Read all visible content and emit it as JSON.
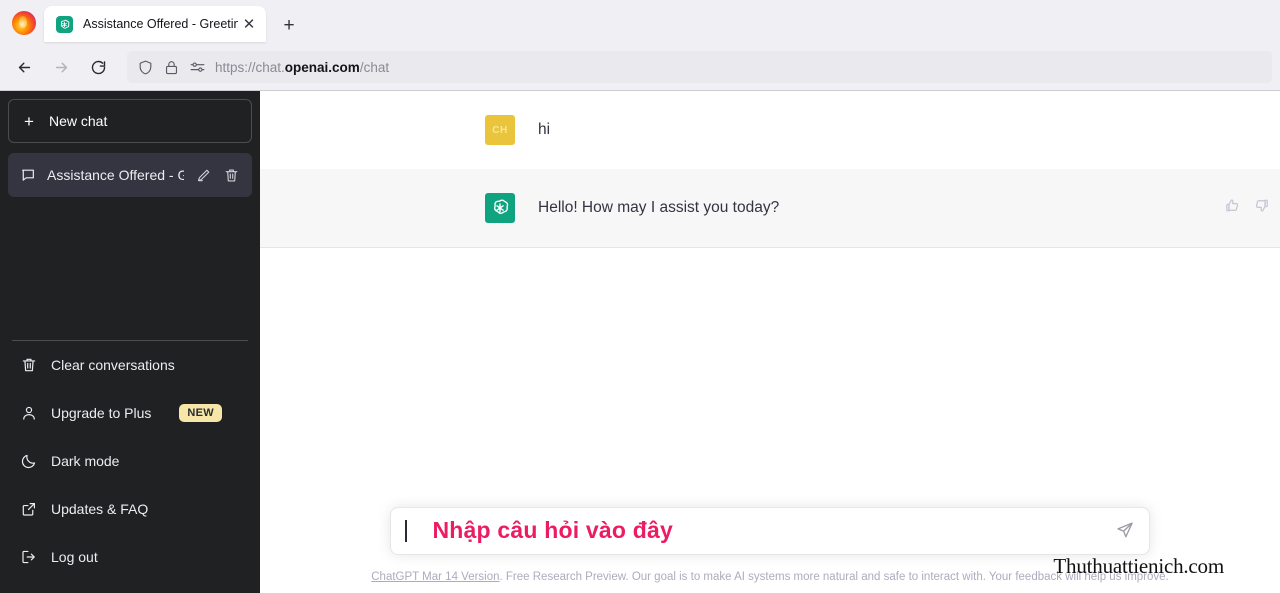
{
  "browser": {
    "logo_icon": "firefox-logo",
    "tab": {
      "favicon": "openai-logo-icon",
      "title": "Assistance Offered - Greeting.",
      "close_label": "✕"
    },
    "new_tab_label": "+",
    "nav": {
      "back_icon": "back-arrow-icon",
      "forward_icon": "forward-arrow-icon",
      "reload_icon": "reload-icon"
    },
    "address": {
      "shield_icon": "shield-icon",
      "lock_icon": "lock-icon",
      "permissions_icon": "site-permissions-icon",
      "url_prefix": "https://chat.",
      "url_domain": "openai.com",
      "url_suffix": "/chat"
    }
  },
  "sidebar": {
    "new_chat": {
      "icon": "plus-icon",
      "label": "New chat"
    },
    "conversation": {
      "icon": "chat-bubble-icon",
      "title": "Assistance Offered - Gr",
      "edit_icon": "pencil-icon",
      "delete_icon": "trash-icon"
    },
    "menu": [
      {
        "icon": "trash-icon",
        "label": "Clear conversations",
        "badge": ""
      },
      {
        "icon": "user-icon",
        "label": "Upgrade to Plus",
        "badge": "NEW"
      },
      {
        "icon": "moon-icon",
        "label": "Dark mode",
        "badge": ""
      },
      {
        "icon": "external-link-icon",
        "label": "Updates & FAQ",
        "badge": ""
      },
      {
        "icon": "logout-icon",
        "label": "Log out",
        "badge": ""
      }
    ]
  },
  "chat": {
    "messages": [
      {
        "role": "user",
        "avatar_initials": "CH",
        "text": "hi"
      },
      {
        "role": "assistant",
        "avatar_icon": "openai-logo-icon",
        "text": "Hello! How may I assist you today?"
      }
    ],
    "feedback": {
      "thumbs_up_icon": "thumbs-up-icon",
      "thumbs_down_icon": "thumbs-down-icon"
    }
  },
  "composer": {
    "value": "",
    "placeholder": "Nhập câu hỏi vào đây",
    "send_icon": "send-paper-plane-icon"
  },
  "footer": {
    "version_link": "ChatGPT Mar 14 Version",
    "text": ". Free Research Preview. Our goal is to make AI systems more natural and safe to interact with. Your feedback will help us improve.",
    "watermark": "Thuthuattienich.com"
  },
  "colors": {
    "sidebar_bg": "#202123",
    "conversation_active_bg": "#343541",
    "assistant_row_bg": "#f7f7f8",
    "openai_green": "#10a37f",
    "user_avatar_yellow": "#eac53b",
    "placeholder_pink": "#ec1c63",
    "badge_yellow": "#f6e6a8"
  }
}
